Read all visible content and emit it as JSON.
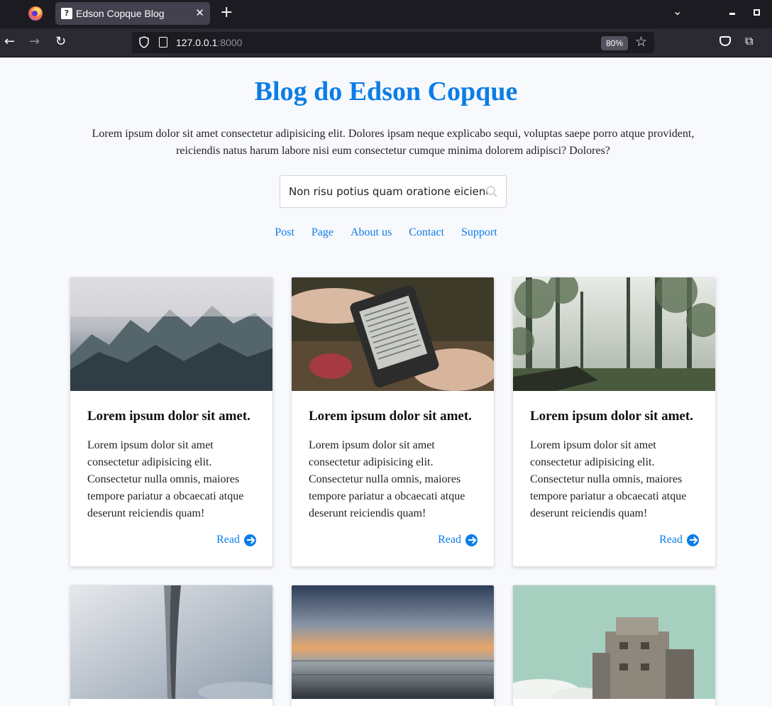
{
  "browser": {
    "tab_title": "Edson Copque Blog",
    "tab_favicon": "?",
    "url_host": "127.0.0.1",
    "url_port": ":8000",
    "zoom": "80%"
  },
  "site": {
    "title": "Blog do Edson Copque",
    "intro": "Lorem ipsum dolor sit amet consectetur adipisicing elit. Dolores ipsam neque explicabo sequi, voluptas saepe porro atque provident, reiciendis natus harum labore nisi eum consectetur cumque minima dolorem adipisci? Dolores?",
    "search_value": "Non risu potius quam oratione eiciendu",
    "menu": [
      "Post",
      "Page",
      "About us",
      "Contact",
      "Support"
    ]
  },
  "cards": [
    {
      "title": "Lorem ipsum dolor sit amet.",
      "text": "Lorem ipsum dolor sit amet consectetur adipisicing elit. Consectetur nulla omnis, maiores tempore pariatur a obcaecati atque deserunt reiciendis quam!",
      "read": "Read",
      "image": "misty-mountains-photo"
    },
    {
      "title": "Lorem ipsum dolor sit amet.",
      "text": "Lorem ipsum dolor sit amet consectetur adipisicing elit. Consectetur nulla omnis, maiores tempore pariatur a obcaecati atque deserunt reiciendis quam!",
      "read": "Read",
      "image": "ereader-in-hand-photo"
    },
    {
      "title": "Lorem ipsum dolor sit amet.",
      "text": "Lorem ipsum dolor sit amet consectetur adipisicing elit. Consectetur nulla omnis, maiores tempore pariatur a obcaecati atque deserunt reiciendis quam!",
      "read": "Read",
      "image": "foggy-forest-photo"
    },
    {
      "image": "sky-tower-photo"
    },
    {
      "image": "sunset-sea-photo"
    },
    {
      "image": "concrete-bunker-photo"
    }
  ]
}
